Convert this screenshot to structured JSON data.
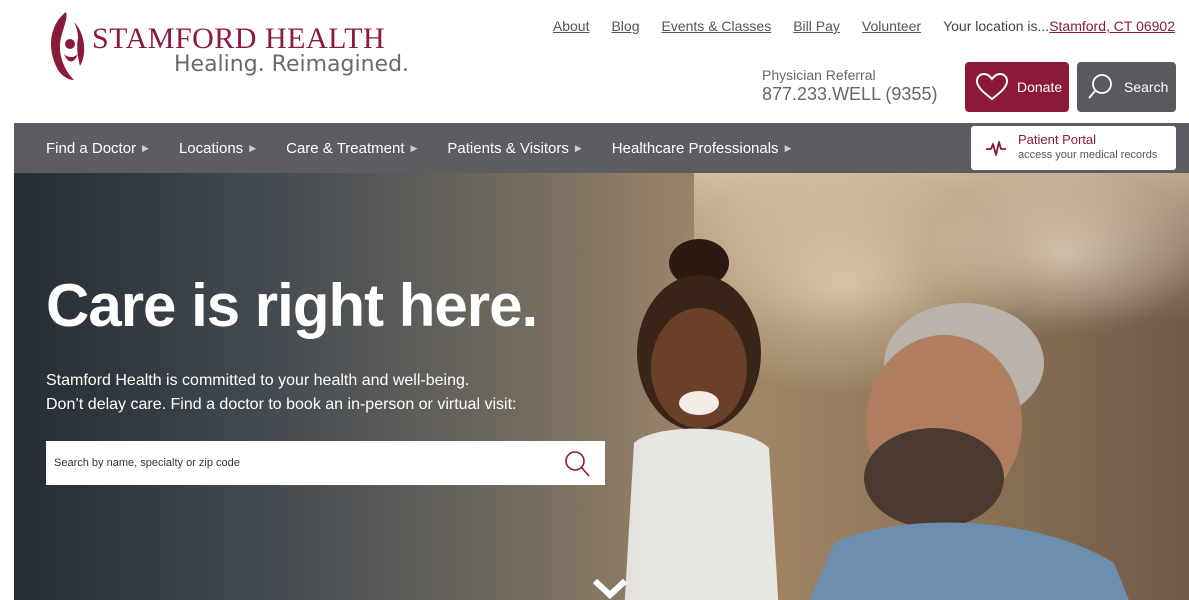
{
  "brand": {
    "name": "STAMFORD HEALTH",
    "tagline": "Healing. Reimagined.",
    "color": "#8b1a3a"
  },
  "top_links": [
    "About",
    "Blog",
    "Events & Classes",
    "Bill Pay",
    "Volunteer"
  ],
  "location": {
    "prefix": "Your location is...",
    "value": "Stamford, CT 06902"
  },
  "referral": {
    "label": "Physician Referral",
    "number": "877.233.WELL (9355)"
  },
  "buttons": {
    "donate": "Donate",
    "search": "Search",
    "donate_icon": "heart-icon",
    "search_icon": "magnifier-icon"
  },
  "nav": {
    "items": [
      "Find a Doctor",
      "Locations",
      "Care & Treatment",
      "Patients & Visitors",
      "Healthcare Professionals"
    ],
    "background": "#5d5c62"
  },
  "portal": {
    "title": "Patient Portal",
    "subtitle": "access your medical records",
    "icon": "heartbeat-icon"
  },
  "hero": {
    "title": "Care is right here.",
    "line1": "Stamford Health is committed to your health and well-being.",
    "line2": "Don’t delay care. Find a doctor to book an in-person or virtual visit:",
    "search_placeholder": "Search by name, specialty or zip code"
  }
}
